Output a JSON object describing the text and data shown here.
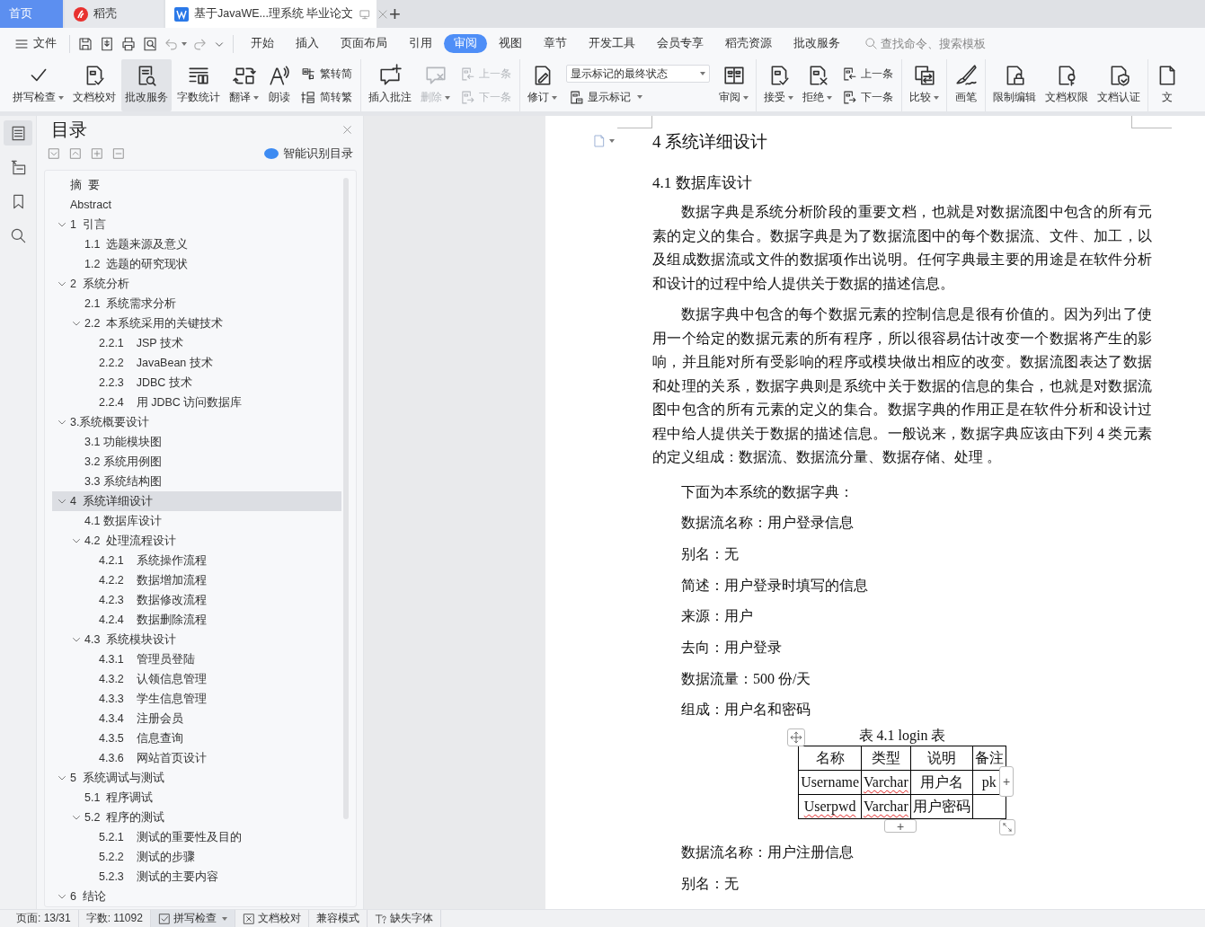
{
  "tabs": [
    {
      "kind": "home",
      "label": "首页",
      "selected": false
    },
    {
      "kind": "app",
      "label": "稻壳",
      "selected": false
    },
    {
      "kind": "doc",
      "label": "基于JavaWE...理系统 毕业论文",
      "selected": true
    }
  ],
  "new_tab": "+",
  "menu": {
    "file": "文件",
    "tabs": [
      {
        "label": "开始",
        "selected": false
      },
      {
        "label": "插入",
        "selected": false
      },
      {
        "label": "页面布局",
        "selected": false
      },
      {
        "label": "引用",
        "selected": false
      },
      {
        "label": "审阅",
        "selected": true
      },
      {
        "label": "视图",
        "selected": false
      },
      {
        "label": "章节",
        "selected": false
      },
      {
        "label": "开发工具",
        "selected": false
      },
      {
        "label": "会员专享",
        "selected": false
      },
      {
        "label": "稻壳资源",
        "selected": false
      },
      {
        "label": "批改服务",
        "selected": false
      }
    ],
    "search": {
      "placeholder": "查找命令、搜索模板"
    }
  },
  "ribbon": {
    "groups": [
      {
        "items": [
          {
            "kind": "large",
            "label": "拼写检查",
            "menu": true,
            "selected": false,
            "disabled": false
          },
          {
            "kind": "large",
            "label": "文档校对",
            "menu": false,
            "selected": false,
            "disabled": false
          },
          {
            "kind": "large",
            "label": "批改服务",
            "menu": false,
            "selected": true,
            "disabled": false
          },
          {
            "kind": "large",
            "label": "字数统计",
            "menu": false,
            "selected": false,
            "disabled": false
          },
          {
            "kind": "large",
            "label": "翻译",
            "menu": true,
            "selected": false,
            "disabled": false
          },
          {
            "kind": "large",
            "label": "朗读",
            "menu": false,
            "selected": false,
            "disabled": false
          },
          {
            "kind": "stack",
            "selected": false,
            "rows": [
              {
                "label": "繁转简",
                "disabled": false
              },
              {
                "label": "简转繁",
                "disabled": false
              }
            ]
          }
        ]
      },
      {
        "items": [
          {
            "kind": "large",
            "label": "插入批注",
            "menu": false,
            "selected": false,
            "disabled": false
          },
          {
            "kind": "large",
            "label": "删除",
            "menu": true,
            "selected": false,
            "disabled": true
          },
          {
            "kind": "stack",
            "selected": false,
            "rows": [
              {
                "label": "上一条",
                "disabled": true
              },
              {
                "label": "下一条",
                "disabled": true
              }
            ]
          }
        ]
      },
      {
        "items": [
          {
            "kind": "large",
            "label": "修订",
            "menu": true,
            "selected": false,
            "disabled": false
          },
          {
            "kind": "select",
            "selected": false,
            "value": "显示标记的最终状态",
            "below": {
              "label": "显示标记",
              "menu": true
            }
          },
          {
            "kind": "large",
            "label": "审阅",
            "menu": true,
            "selected": false,
            "disabled": false
          }
        ]
      },
      {
        "items": [
          {
            "kind": "large",
            "label": "接受",
            "menu": true,
            "selected": false,
            "disabled": false
          },
          {
            "kind": "large",
            "label": "拒绝",
            "menu": true,
            "selected": false,
            "disabled": false
          },
          {
            "kind": "stack",
            "selected": false,
            "rows": [
              {
                "label": "上一条",
                "disabled": false
              },
              {
                "label": "下一条",
                "disabled": false
              }
            ]
          }
        ]
      },
      {
        "items": [
          {
            "kind": "large",
            "label": "比较",
            "menu": true,
            "selected": false,
            "disabled": false
          }
        ]
      },
      {
        "items": [
          {
            "kind": "large",
            "label": "画笔",
            "menu": false,
            "selected": false,
            "disabled": false
          }
        ]
      },
      {
        "items": [
          {
            "kind": "large",
            "label": "限制编辑",
            "menu": false,
            "selected": false,
            "disabled": false
          },
          {
            "kind": "large",
            "label": "文档权限",
            "menu": false,
            "selected": false,
            "disabled": false
          },
          {
            "kind": "large",
            "label": "文档认证",
            "menu": false,
            "selected": false,
            "disabled": false
          }
        ]
      },
      {
        "items": [
          {
            "kind": "large",
            "label": "文",
            "menu": false,
            "selected": false,
            "disabled": false
          }
        ]
      }
    ]
  },
  "side_rail": [
    {
      "selected": true
    },
    {
      "selected": false
    },
    {
      "selected": false
    },
    {
      "selected": false
    }
  ],
  "toc": {
    "title": "目录",
    "smart_button": "智能识别目录",
    "items": [
      {
        "label": "摘  要",
        "selected": false
      },
      {
        "label": "Abstract",
        "selected": false
      },
      {
        "label": "1  引言",
        "selected": false,
        "expanded": true,
        "children": [
          {
            "label": "1.1  选题来源及意义",
            "selected": false
          },
          {
            "label": "1.2  选题的研究现状",
            "selected": false
          }
        ]
      },
      {
        "label": "2  系统分析",
        "selected": false,
        "expanded": true,
        "children": [
          {
            "label": "2.1  系统需求分析",
            "selected": false
          },
          {
            "label": "2.2  本系统采用的关键技术",
            "selected": false,
            "expanded": true,
            "children": [
              {
                "label": "2.2.1    JSP 技术",
                "selected": false
              },
              {
                "label": "2.2.2    JavaBean 技术",
                "selected": false
              },
              {
                "label": "2.2.3    JDBC 技术",
                "selected": false
              },
              {
                "label": "2.2.4    用 JDBC 访问数据库",
                "selected": false
              }
            ]
          }
        ]
      },
      {
        "label": "3.系统概要设计",
        "selected": false,
        "expanded": true,
        "children": [
          {
            "label": "3.1 功能模块图",
            "selected": false
          },
          {
            "label": "3.2 系统用例图",
            "selected": false
          },
          {
            "label": "3.3 系统结构图",
            "selected": false
          }
        ]
      },
      {
        "label": "4  系统详细设计",
        "selected": true,
        "expanded": true,
        "children": [
          {
            "label": "4.1 数据库设计",
            "selected": false
          },
          {
            "label": "4.2  处理流程设计",
            "selected": false,
            "expanded": true,
            "children": [
              {
                "label": "4.2.1    系统操作流程",
                "selected": false
              },
              {
                "label": "4.2.2    数据增加流程",
                "selected": false
              },
              {
                "label": "4.2.3    数据修改流程",
                "selected": false
              },
              {
                "label": "4.2.4    数据删除流程",
                "selected": false
              }
            ]
          },
          {
            "label": "4.3  系统模块设计",
            "selected": false,
            "expanded": true,
            "children": [
              {
                "label": "4.3.1    管理员登陆",
                "selected": false
              },
              {
                "label": "4.3.2    认领信息管理",
                "selected": false
              },
              {
                "label": "4.3.3    学生信息管理",
                "selected": false
              },
              {
                "label": "4.3.4    注册会员",
                "selected": false
              },
              {
                "label": "4.3.5    信息查询",
                "selected": false
              },
              {
                "label": "4.3.6    网站首页设计",
                "selected": false
              }
            ]
          }
        ]
      },
      {
        "label": "5  系统调试与测试",
        "selected": false,
        "expanded": true,
        "children": [
          {
            "label": "5.1  程序调试",
            "selected": false
          },
          {
            "label": "5.2  程序的测试",
            "selected": false,
            "expanded": true,
            "children": [
              {
                "label": "5.2.1    测试的重要性及目的",
                "selected": false
              },
              {
                "label": "5.2.2    测试的步骤",
                "selected": false
              },
              {
                "label": "5.2.3    测试的主要内容",
                "selected": false
              }
            ]
          }
        ]
      },
      {
        "label": "6  结论",
        "selected": false,
        "expanded": true
      }
    ]
  },
  "document": {
    "blocks": [
      {
        "kind": "h1",
        "text": "4  系统详细设计"
      },
      {
        "kind": "h2",
        "text": "4.1 数据库设计"
      },
      {
        "kind": "para",
        "text": "数据字典是系统分析阶段的重要文档，也就是对数据流图中包含的所有元素的定义的集合。数据字典是为了数据流图中的每个数据流、文件、加工，以及组成数据流或文件的数据项作出说明。任何字典最主要的用途是在软件分析和设计的过程中给人提供关于数据的描述信息。"
      },
      {
        "kind": "para",
        "text": "数据字典中包含的每个数据元素的控制信息是很有价值的。因为列出了使用一个给定的数据元素的所有程序，所以很容易估计改变一个数据将产生的影响，并且能对所有受影响的程序或模块做出相应的改变。数据流图表达了数据和处理的关系，数据字典则是系统中关于数据的信息的集合，也就是对数据流图中包含的所有元素的定义的集合。数据字典的作用正是在软件分析和设计过程中给人提供关于数据的描述信息。一般说来，数据字典应该由下列 4 类元素的定义组成：数据流、数据流分量、数据存储、处理 。"
      },
      {
        "kind": "line",
        "text": "下面为本系统的数据字典："
      },
      {
        "kind": "line",
        "text": "数据流名称：用户登录信息"
      },
      {
        "kind": "line",
        "text": "别名：无"
      },
      {
        "kind": "line",
        "text": "简述：用户登录时填写的信息"
      },
      {
        "kind": "line",
        "text": "来源：用户"
      },
      {
        "kind": "line",
        "text": "去向：用户登录"
      },
      {
        "kind": "line",
        "text": "数据流量：500 份/天"
      },
      {
        "kind": "line",
        "text": "组成：用户名和密码"
      },
      {
        "kind": "table",
        "caption": "表 4.1 login 表",
        "add_column": "+",
        "add_row": "+",
        "columns": [
          "名称",
          "类型",
          "说明",
          "备注"
        ],
        "rows": [
          [
            {
              "text": "Username",
              "misspelled": false
            },
            {
              "text": "Varchar",
              "misspelled": true
            },
            {
              "text": "用户名",
              "misspelled": false
            },
            {
              "text": "pk",
              "misspelled": false
            }
          ],
          [
            {
              "text": "Userpwd",
              "misspelled": true
            },
            {
              "text": "Varchar",
              "misspelled": true
            },
            {
              "text": "用户密码",
              "misspelled": false
            }
          ]
        ]
      },
      {
        "kind": "line",
        "text": "数据流名称：用户注册信息"
      },
      {
        "kind": "line",
        "text": "别名：无"
      }
    ]
  },
  "status_bar": [
    {
      "kind": "text",
      "label": "页面: 13/31",
      "active": false
    },
    {
      "kind": "text",
      "label": "字数: 11092",
      "active": false
    },
    {
      "kind": "check",
      "label": "拼写检查",
      "menu": true,
      "active": true
    },
    {
      "kind": "proof",
      "label": "文档校对",
      "active": false
    },
    {
      "kind": "text",
      "label": "兼容模式",
      "active": false
    },
    {
      "kind": "font",
      "label": "缺失字体",
      "active": false
    }
  ]
}
